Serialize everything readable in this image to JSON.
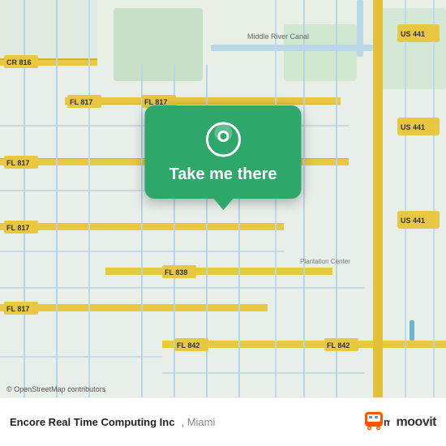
{
  "map": {
    "background_color": "#e8efe8",
    "osm_credit": "© OpenStreetMap contributors"
  },
  "popup": {
    "button_label": "Take me there",
    "pin_color": "#ffffff"
  },
  "bottom_bar": {
    "location_name": "Encore Real Time Computing Inc",
    "location_city": "Miami",
    "moovit_label": "moovit",
    "copyright": "© OpenStreetMap contributors"
  }
}
